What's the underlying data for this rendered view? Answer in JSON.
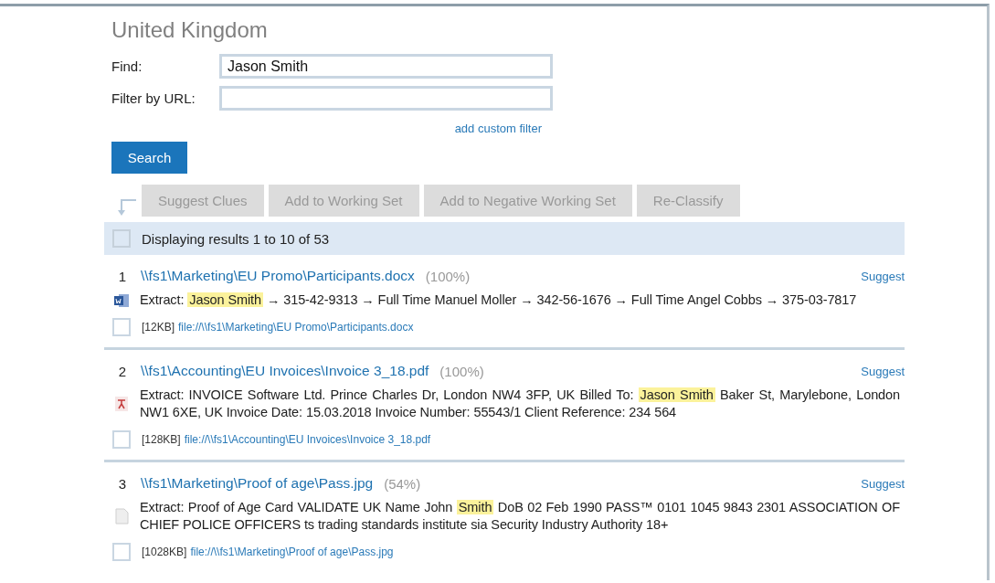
{
  "title": "United Kingdom",
  "form": {
    "find_label": "Find:",
    "find_value": "Jason Smith",
    "filter_label": "Filter by URL:",
    "custom_filter_link": "add custom filter",
    "search_button": "Search"
  },
  "toolbar": [
    {
      "label": "Suggest Clues",
      "disabled": true
    },
    {
      "label": "Add to Working Set",
      "disabled": true
    },
    {
      "label": "Add to Negative Working Set",
      "disabled": true
    },
    {
      "label": "Re-Classify",
      "disabled": true
    }
  ],
  "results_header": {
    "checked": false,
    "text": "Displaying results 1 to 10 of 53"
  },
  "results": [
    {
      "number": "1",
      "path": "\\\\fs1\\Marketing\\EU Promo\\Participants.docx",
      "score": "(100%)",
      "suggest": "Suggest",
      "kind": "word",
      "checked": false,
      "size": "[12KB]",
      "url": "file://\\\\fs1\\Marketing\\EU Promo\\Participants.docx",
      "extract": [
        {
          "text": "Extract: ",
          "highlight": false
        },
        {
          "text": "Jason Smith",
          "highlight": true
        },
        {
          "text": " → 315-42-9313 → Full Time Manuel Moller → 342-56-1676 → Full Time Angel Cobbs → 375-03-7817",
          "highlight": false
        }
      ]
    },
    {
      "number": "2",
      "path": "\\\\fs1\\Accounting\\EU Invoices\\Invoice 3_18.pdf",
      "score": "(100%)",
      "suggest": "Suggest",
      "kind": "pdf",
      "checked": false,
      "size": "[128KB]",
      "url": "file://\\\\fs1\\Accounting\\EU Invoices\\Invoice 3_18.pdf",
      "extract": [
        {
          "text": "Extract: INVOICE Software Ltd. Prince Charles Dr, London NW4 3FP, UK Billed To: ",
          "highlight": false
        },
        {
          "text": "Jason Smith",
          "highlight": true
        },
        {
          "text": " Baker St, Marylebone, London NW1 6XE, UK Invoice Date: 15.03.2018 Invoice Number: 55543/1 Client Reference: 234 564",
          "highlight": false
        }
      ]
    },
    {
      "number": "3",
      "path": "\\\\fs1\\Marketing\\Proof of age\\Pass.jpg",
      "score": "(54%)",
      "suggest": "Suggest",
      "kind": "generic",
      "checked": false,
      "size": "[1028KB]",
      "url": "file://\\\\fs1\\Marketing\\Proof of age\\Pass.jpg",
      "extract": [
        {
          "text": "Extract: Proof of Age Card VALIDATE UK Name John ",
          "highlight": false
        },
        {
          "text": "Smith",
          "highlight": true
        },
        {
          "text": " DoB 02 Feb 1990 PASS™ 0101 1045 9843 2301 ASSOCIATION OF CHIEF POLICE OFFICERS ts trading standards institute sia Security Industry Authority 18+",
          "highlight": false
        }
      ]
    }
  ]
}
